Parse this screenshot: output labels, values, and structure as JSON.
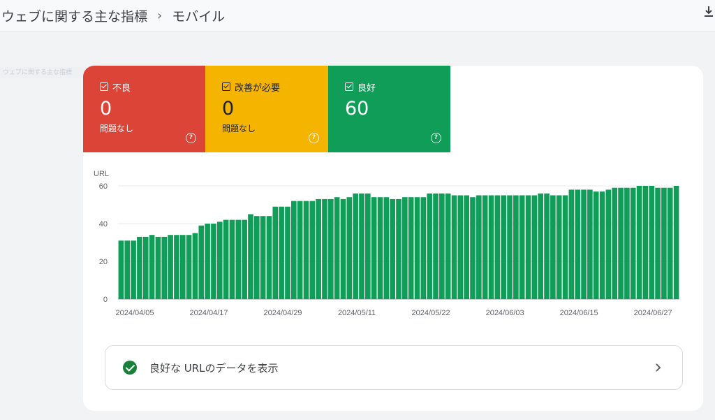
{
  "header": {
    "breadcrumb_parent": "ウェブに関する主な指標",
    "breadcrumb_sep": "›",
    "breadcrumb_current": "モバイル"
  },
  "background_text": "ウェブに関する主な指標",
  "tiles": {
    "poor": {
      "label": "不良",
      "count": "0",
      "sub": "問題なし",
      "color": "#db4437"
    },
    "needs_improvement": {
      "label": "改善が必要",
      "count": "0",
      "sub": "問題なし",
      "color": "#f4b400"
    },
    "good": {
      "label": "良好",
      "count": "60",
      "sub": "",
      "color": "#0f9d58"
    }
  },
  "chart_data": {
    "type": "bar",
    "ylabel": "URL",
    "ylim": [
      0,
      60
    ],
    "yticks": [
      0,
      20,
      40,
      60
    ],
    "color": "#0f9d58",
    "start_date": "2024/04/05",
    "x_tick_labels": [
      "2024/04/05",
      "2024/04/17",
      "2024/04/29",
      "2024/05/11",
      "2024/05/22",
      "2024/06/03",
      "2024/06/15",
      "2024/06/27"
    ],
    "values": [
      31,
      31,
      31,
      33,
      33,
      34,
      33,
      33,
      34,
      34,
      34,
      34,
      35,
      39,
      40,
      40,
      41,
      42,
      42,
      42,
      42,
      45,
      44,
      44,
      44,
      49,
      49,
      49,
      52,
      52,
      52,
      52,
      53,
      53,
      53,
      54,
      53,
      54,
      56,
      56,
      56,
      54,
      54,
      54,
      53,
      53,
      54,
      54,
      54,
      54,
      56,
      56,
      56,
      56,
      55,
      55,
      55,
      54,
      55,
      55,
      55,
      55,
      55,
      55,
      55,
      55,
      55,
      55,
      56,
      56,
      55,
      55,
      55,
      58,
      58,
      58,
      58,
      57,
      57,
      58,
      59,
      59,
      59,
      59,
      60,
      60,
      60,
      59,
      59,
      59,
      60
    ]
  },
  "link_row": {
    "label": "良好な URLのデータを表示"
  },
  "icons": {
    "check": "checkbox-icon",
    "help": "help-circle-icon",
    "ok": "check-circle-icon",
    "chevron": "chevron-right-icon",
    "download": "download-icon"
  }
}
